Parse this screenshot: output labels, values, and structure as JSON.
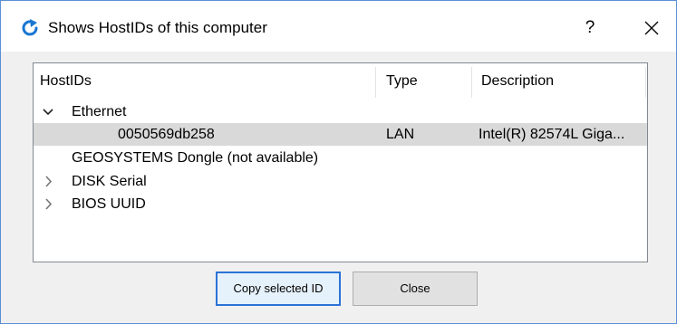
{
  "window": {
    "title": "Shows HostIDs of this computer",
    "help_label": "?"
  },
  "tree": {
    "columns": [
      "HostIDs",
      "Type",
      "Description"
    ],
    "rows": [
      {
        "name": "Ethernet",
        "type": "",
        "description": "",
        "expander": "expanded"
      },
      {
        "name": "0050569db258",
        "type": "LAN",
        "description": "Intel(R) 82574L Giga...",
        "selected": true
      },
      {
        "name": "GEOSYSTEMS Dongle (not available)",
        "type": "",
        "description": ""
      },
      {
        "name": "DISK Serial",
        "type": "",
        "description": "",
        "expander": "collapsed"
      },
      {
        "name": "BIOS UUID",
        "type": "",
        "description": "",
        "expander": "collapsed"
      }
    ]
  },
  "buttons": {
    "copy_label": "Copy selected ID",
    "close_label": "Close"
  },
  "colors": {
    "accent": "#2b73d6",
    "selection": "#d9d9d9",
    "icon": "#1976d2"
  }
}
